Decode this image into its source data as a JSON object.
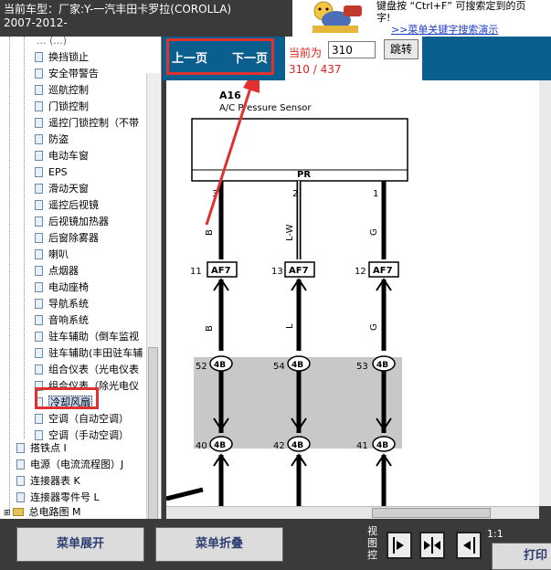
{
  "header": {
    "vehicle_line1": "当前车型：厂家:Y-一汽丰田卡罗拉(COROLLA)",
    "vehicle_line2": "2007-2012-",
    "hint_line1": "键盘按 “Ctrl+F” 可搜索定到的页",
    "hint_line2": "字!",
    "hint_link": ">>菜单关键字搜索演示"
  },
  "sidebar": {
    "cut_top": "... (...)",
    "items": [
      "换挡锁止",
      "安全带警告",
      "巡航控制",
      "门锁控制",
      "遥控门锁控制（不带",
      "防盗",
      "电动车窗",
      "EPS",
      "滑动天窗",
      "遥控后视镜",
      "后视镜加热器",
      "后窗除雾器",
      "喇叭",
      "点烟器",
      "电动座椅",
      "导航系统",
      "音响系统",
      "驻车辅助（倒车监视",
      "驻车辅助(丰田驻车辅",
      "组合仪表（光电仪表",
      "组合仪表（除光电仪",
      "冷却风扇",
      "空调（自动空调）",
      "空调（手动空调）"
    ],
    "selected": "冷却风扇",
    "top_items": [
      "搭铁点 I",
      "电源（电流流程图）J",
      "连接器表 K",
      "连接器零件号 L",
      "总电路图 M"
    ]
  },
  "viewer": {
    "prev_page": "上一页",
    "next_page": "下一页",
    "current_label": "当前为",
    "current_page": "310",
    "total_label": "310 / 437",
    "jump_label": "跳转"
  },
  "diagram": {
    "component_id": "A16",
    "component_name": "A/C Pressure Sensor",
    "pins": [
      {
        "num": "3",
        "label": "PR",
        "wire": "B",
        "conn": "AF7",
        "conn_pin": "11",
        "mid_wire": "B",
        "j_top": "52",
        "j_bot": "40"
      },
      {
        "num": "2",
        "label": "PR",
        "wire": "L-W",
        "conn": "AF7",
        "conn_pin": "13",
        "mid_wire": "L",
        "j_top": "54",
        "j_bot": "42"
      },
      {
        "num": "1",
        "label": "",
        "wire": "G",
        "conn": "AF7",
        "conn_pin": "12",
        "mid_wire": "G",
        "j_top": "53",
        "j_bot": "41"
      }
    ],
    "junction": "4B"
  },
  "bottom": {
    "expand": "菜单展开",
    "collapse": "菜单折叠",
    "view_label": "视图控",
    "ratio": "1:1",
    "print": "打印"
  },
  "colors": {
    "accent": "#0b5f8f",
    "highlight": "#e03030"
  }
}
